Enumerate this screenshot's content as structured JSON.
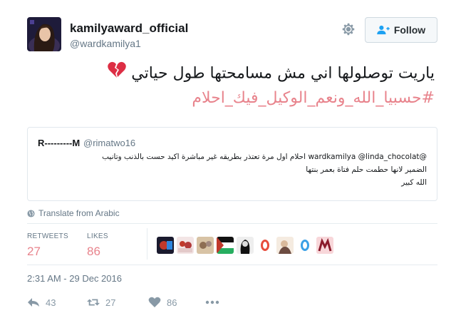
{
  "account": {
    "display_name": "kamilyaward_official",
    "handle": "@wardkamilya1"
  },
  "follow_button": {
    "label": "Follow"
  },
  "tweet": {
    "text": "ياريت توصلولها اني مش مسامحتها طول حياتي",
    "hashtag": "#حسبيا_الله_ونعم_الوكيل_فيك_احلام",
    "emoji": "broken-heart",
    "accent_color": "#e8838c"
  },
  "quoted_tweet": {
    "author": "R---------M",
    "handle": "@rimatwo16",
    "line1": "@wardkamilya @linda_chocolat احلام اول مرة تعتذر بطريقه غير مباشرة اكيد حست بالذنب وتانيب",
    "line2": "الضمير لانها حطمت حلم فتاة بعمر بنتها",
    "line3": "الله كبير"
  },
  "translate": {
    "label": "Translate from Arabic"
  },
  "stats": {
    "retweets_label": "RETWEETS",
    "retweets_value": "27",
    "likes_label": "LIKES",
    "likes_value": "86"
  },
  "timestamp": "2:31 AM - 29 Dec 2016",
  "actions": {
    "reply_count": "43",
    "retweet_count": "27",
    "like_count": "86"
  }
}
